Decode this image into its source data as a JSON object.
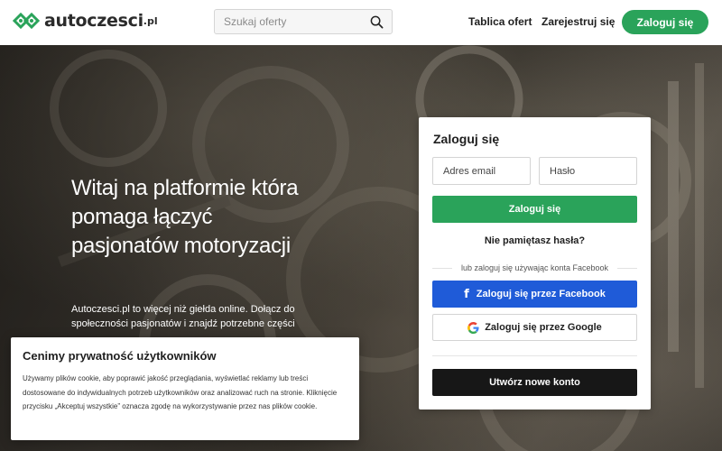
{
  "header": {
    "logo_text": "autoczesci",
    "logo_suffix": ".pl",
    "search_placeholder": "Szukaj oferty",
    "nav": {
      "board": "Tablica ofert",
      "register": "Zarejestruj się",
      "login": "Zaloguj się"
    }
  },
  "hero": {
    "title": "Witaj na platformie która pomaga łączyć pasjonatów motoryzacji",
    "text": "Autoczesci.pl to więcej niż giełda online. Dołącz do społeczności pasjonatów i znajdź potrzebne części"
  },
  "login": {
    "title": "Zaloguj się",
    "email_placeholder": "Adres email",
    "password_placeholder": "Hasło",
    "submit": "Zaloguj się",
    "forgot": "Nie pamiętasz hasła?",
    "divider": "lub zaloguj się używając konta Facebook",
    "facebook": "Zaloguj się przez Facebook",
    "google": "Zaloguj się przez Google",
    "create": "Utwórz nowe konto"
  },
  "cookie": {
    "title": "Cenimy prywatność użytkowników",
    "body": "Używamy plików cookie, aby poprawić jakość przeglądania, wyświetlać reklamy lub treści dostosowane do indywidualnych potrzeb użytkowników oraz analizować ruch na stronie. Kliknięcie przycisku „Akceptuj wszystkie” oznacza zgodę na wykorzystywanie przez nas plików cookie."
  },
  "colors": {
    "brand_green": "#2aa35a",
    "facebook_blue": "#1f5bd8",
    "dark_button": "#171717"
  },
  "icons": {
    "logo": "logo-mark-icon",
    "search": "search-icon",
    "facebook": "facebook-icon",
    "google": "google-icon"
  }
}
